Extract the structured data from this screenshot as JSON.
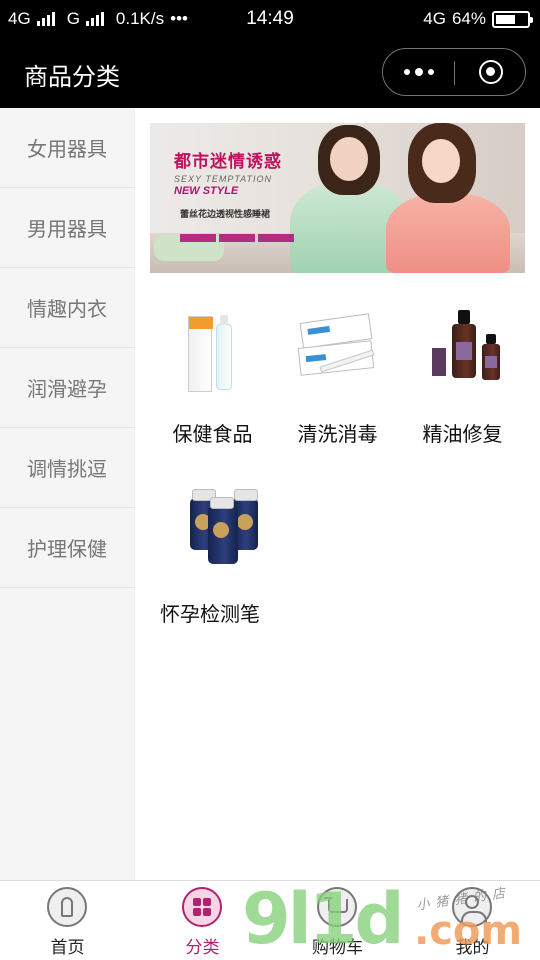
{
  "status_bar": {
    "network1": "4G",
    "network2": "G",
    "speed": "0.1K/s",
    "dots": "•••",
    "time": "14:49",
    "network3": "4G",
    "battery": "64%",
    "battery_level": 0.64
  },
  "nav": {
    "title": "商品分类"
  },
  "sidebar": {
    "items": [
      {
        "label": "女用器具"
      },
      {
        "label": "男用器具"
      },
      {
        "label": "情趣内衣"
      },
      {
        "label": "润滑避孕"
      },
      {
        "label": "调情挑逗"
      },
      {
        "label": "护理保健"
      }
    ],
    "active_index": 5
  },
  "banner": {
    "title_cn": "都市迷情诱惑",
    "title_en": "SEXY TEMPTATION",
    "new_style": "NEW STYLE",
    "subtitle": "蕾丝花边透视性感睡裙"
  },
  "categories": [
    {
      "label": "保健食品",
      "icon": "health-food-product"
    },
    {
      "label": "清洗消毒",
      "icon": "test-strip-product"
    },
    {
      "label": "精油修复",
      "icon": "essential-oil-product"
    },
    {
      "label": "怀孕检测笔",
      "icon": "supplement-jar-product"
    }
  ],
  "tab_bar": {
    "tabs": [
      {
        "label": "首页",
        "icon": "home-icon"
      },
      {
        "label": "分类",
        "icon": "category-icon"
      },
      {
        "label": "购物车",
        "icon": "cart-icon"
      },
      {
        "label": "我的",
        "icon": "user-icon"
      }
    ],
    "active_index": 1
  },
  "watermark": {
    "main": "9l1d",
    "com": ".com",
    "small": "小猪猪的店"
  },
  "colors": {
    "accent": "#b0226b",
    "header_bg": "#000000",
    "sidebar_bg": "#f5f5f5"
  }
}
